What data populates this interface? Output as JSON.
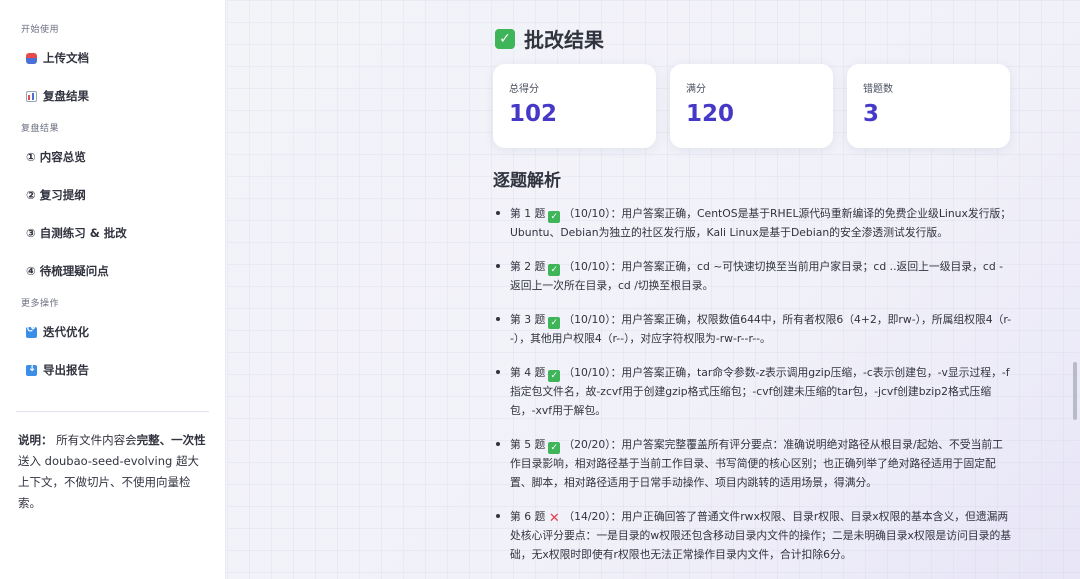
{
  "sidebar": {
    "section_start": "开始使用",
    "upload": "上传文档",
    "review_results": "复盘结果",
    "section_review": "复盘结果",
    "overview": "① 内容总览",
    "outline": "② 复习提纲",
    "practice": "③ 自测练习 & 批改",
    "questions": "④ 待梳理疑问点",
    "section_more": "更多操作",
    "iterate": "迭代优化",
    "export": "导出报告",
    "note_label": "说明：",
    "note_part1": "所有文件内容会",
    "note_bold": "完整、一次性",
    "note_part2": "送入 doubao-seed-evolving 超大上下文，不做切片、不使用向量检索。"
  },
  "main": {
    "title": "批改结果",
    "cards": [
      {
        "label": "总得分",
        "value": "102"
      },
      {
        "label": "满分",
        "value": "120"
      },
      {
        "label": "错题数",
        "value": "3"
      }
    ],
    "section_title": "逐题解析",
    "items": [
      {
        "q": "第 1 题",
        "mark": "ok",
        "text": "（10/10）：用户答案正确，CentOS是基于RHEL源代码重新编译的免费企业级Linux发行版；Ubuntu、Debian为独立的社区发行版，Kali Linux是基于Debian的安全渗透测试发行版。"
      },
      {
        "q": "第 2 题",
        "mark": "ok",
        "text": "（10/10）：用户答案正确，cd ~可快速切换至当前用户家目录；cd ..返回上一级目录，cd -返回上一次所在目录，cd /切换至根目录。"
      },
      {
        "q": "第 3 题",
        "mark": "ok",
        "text": "（10/10）：用户答案正确，权限数值644中，所有者权限6（4+2，即rw-），所属组权限4（r--），其他用户权限4（r--），对应字符权限为-rw-r--r--。"
      },
      {
        "q": "第 4 题",
        "mark": "ok",
        "text": "（10/10）：用户答案正确，tar命令参数-z表示调用gzip压缩，-c表示创建包，-v显示过程，-f指定包文件名，故-zcvf用于创建gzip格式压缩包；-cvf创建未压缩的tar包，-jcvf创建bzip2格式压缩包，-xvf用于解包。"
      },
      {
        "q": "第 5 题",
        "mark": "ok",
        "text": "（20/20）：用户答案完整覆盖所有评分要点：准确说明绝对路径从根目录/起始、不受当前工作目录影响，相对路径基于当前工作目录、书写简便的核心区别；也正确列举了绝对路径适用于固定配置、脚本，相对路径适用于日常手动操作、项目内跳转的适用场景，得满分。"
      },
      {
        "q": "第 6 题",
        "mark": "bad",
        "text": "（14/20）：用户正确回答了普通文件rwx权限、目录r权限、目录x权限的基本含义，但遗漏两处核心评分要点：一是目录的w权限还包含移动目录内文件的操作；二是未明确目录x权限是访问目录的基础，无x权限时即使有r权限也无法正常操作目录内文件，合计扣除6分。"
      }
    ],
    "mark_ok_glyph": "✓",
    "mark_bad_glyph": "✕"
  }
}
